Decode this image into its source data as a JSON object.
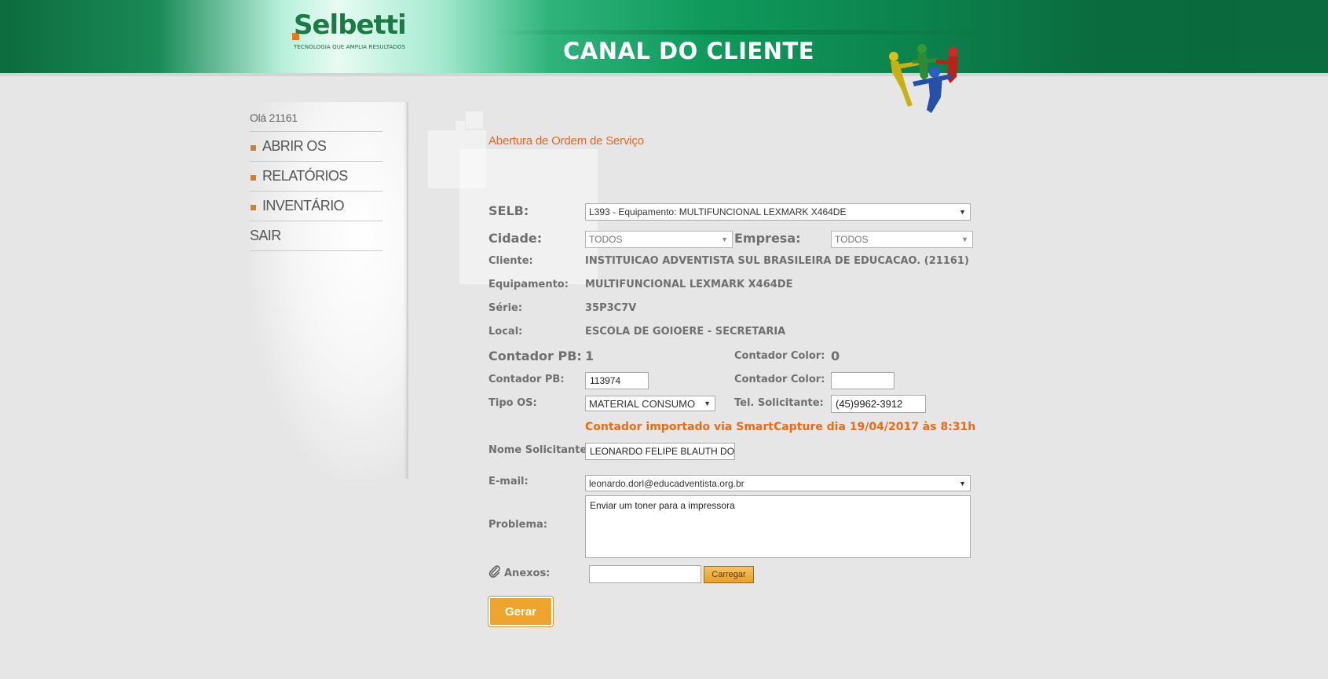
{
  "header": {
    "logo_text": "Selbetti",
    "logo_tagline": "TECNOLOGIA QUE AMPLIA RESULTADOS",
    "title": "CANAL DO CLIENTE"
  },
  "sidebar": {
    "greeting": "Olá 21161",
    "items": [
      {
        "label": "ABRIR OS"
      },
      {
        "label": "RELATÓRIOS"
      },
      {
        "label": "INVENTÁRIO"
      },
      {
        "label": "SAIR"
      }
    ]
  },
  "form": {
    "page_title": "Abertura de Ordem de Serviço",
    "selb_label": "SELB:",
    "selb_value": "L393 - Equipamento: MULTIFUNCIONAL  LEXMARK X464DE",
    "cidade_label": "Cidade:",
    "cidade_value": "TODOS",
    "empresa_label": "Empresa:",
    "empresa_value": "TODOS",
    "cliente_label": "Cliente:",
    "cliente_value": "INSTITUICAO ADVENTISTA SUL BRASILEIRA DE EDUCACAO. (21161)",
    "equipamento_label": "Equipamento:",
    "equipamento_value": "MULTIFUNCIONAL LEXMARK X464DE",
    "serie_label": "Série:",
    "serie_value": "35P3C7V",
    "local_label": "Local:",
    "local_value": "ESCOLA DE GOIOERE - SECRETARIA",
    "contador_pb_label": "Contador PB:",
    "contador_pb_current": "1",
    "contador_color_label": "Contador Color:",
    "contador_color_current": "0",
    "contador_pb_input_label": "Contador PB:",
    "contador_pb_input": "113974",
    "contador_color_input_label": "Contador Color:",
    "contador_color_input": "",
    "tipo_os_label": "Tipo OS:",
    "tipo_os_value": "MATERIAL CONSUMO",
    "tel_label": "Tel. Solicitante:",
    "tel_value": "(45)9962-3912",
    "smartcapture_note": "Contador importado via SmartCapture dia 19/04/2017 às 8:31h",
    "nome_label": "Nome Solicitante:",
    "nome_value": "LEONARDO FELIPE BLAUTH DORL",
    "email_label": "E-mail:",
    "email_value": "leonardo.dorl@educadventista.org.br",
    "problema_label": "Problema:",
    "problema_value": "Enviar um toner para a impressora",
    "anexos_label": "Anexos:",
    "anexos_value": "",
    "carregar_label": "Carregar",
    "gerar_label": "Gerar"
  },
  "colors": {
    "accent_orange": "#e8661c",
    "brand_green": "#0c7f4b",
    "button_orange": "#eea42d"
  }
}
